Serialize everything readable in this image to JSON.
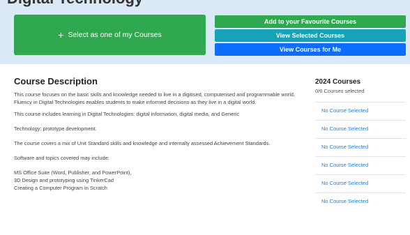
{
  "header": {
    "title": "Digital Technology"
  },
  "actions": {
    "select_label": "Select as one of my Courses",
    "favourite_label": "Add to your Favourite Courses",
    "view_selected_label": "View Selected Courses",
    "view_for_me_label": "View Courses for Me",
    "colors": {
      "green": "#2fa84f",
      "teal": "#17a2b8",
      "blue": "#0d6efd"
    }
  },
  "description": {
    "heading": "Course Description",
    "paragraphs": [
      "This course focuses on the basic skills and knowledge needed to live in a digitised, computerised and programmable world. Fluency in Digital Technologies enables students to make informed decisions as they live in a digital world.",
      "This course includes learning in Digital Technologies: digital information, digital media, and Generic",
      "Technology: prototype development.",
      "The course covers a mix of Unit Standard skills and knowledge and internally assessed Achievement Standards.",
      "Software and topics covered may include:"
    ],
    "list": [
      "MS Office Suite (Word, Publisher, and PowerPoint),",
      "3D Design and prototyping using TinkerCad",
      "Creating a Computer Program in Scratch"
    ]
  },
  "courses": {
    "heading": "2024 Courses",
    "count_text": "0/6 Courses selected",
    "slots": [
      "No Course Selected",
      "No Course Selected",
      "No Course Selected",
      "No Course Selected",
      "No Course Selected",
      "No Course Selected"
    ]
  }
}
